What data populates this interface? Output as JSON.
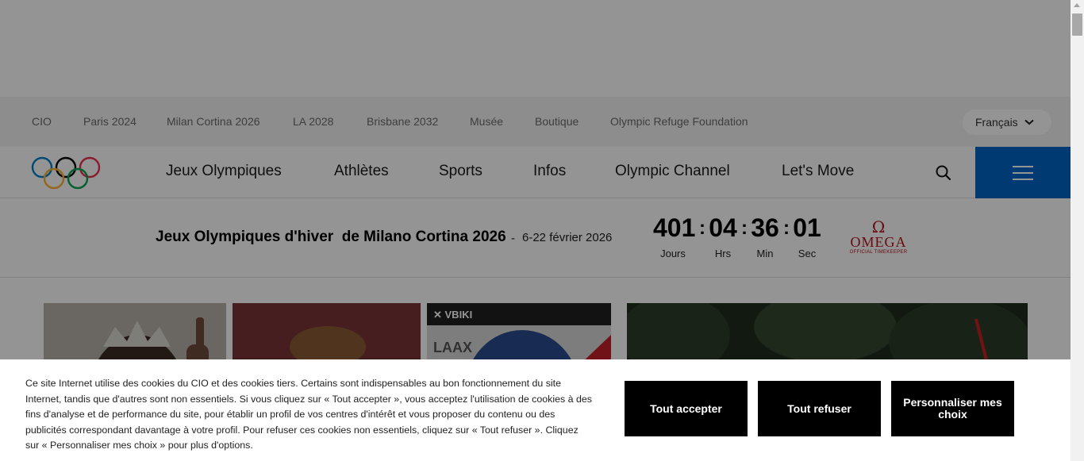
{
  "topbar": {
    "links": [
      "CIO",
      "Paris 2024",
      "Milan Cortina 2026",
      "LA 2028",
      "Brisbane 2032",
      "Musée",
      "Boutique",
      "Olympic Refuge Foundation"
    ],
    "language": "Français"
  },
  "mainnav": {
    "items": [
      "Jeux Olympiques",
      "Athlètes",
      "Sports",
      "Infos",
      "Olympic Channel",
      "Let's Move"
    ]
  },
  "countdown": {
    "title": "Jeux Olympiques d'hiver  de Milano Cortina 2026",
    "dash": "-",
    "dates": "6-22 février 2026",
    "units": [
      {
        "value": "401",
        "label": "Jours"
      },
      {
        "value": "04",
        "label": "Hrs"
      },
      {
        "value": "36",
        "label": "Min"
      },
      {
        "value": "01",
        "label": "Sec"
      }
    ],
    "separator": ":",
    "sponsor": {
      "symbol": "Ω",
      "name": "OMEGA",
      "tagline": "OFFICIAL TIMEKEEPER"
    }
  },
  "cookie_banner": {
    "text": "Ce site Internet utilise des cookies du CIO et des cookies tiers. Certains sont indispensables au bon fonctionnement du site Internet, tandis que d'autres sont non essentiels. Si vous cliquez sur « Tout accepter », vous acceptez l'utilisation de cookies à des fins d'analyse et de performance du site, pour établir un profil de vos centres d'intérêt et vous proposer du contenu ou des publicités correspondant davantage à votre profil. Pour refuser ces cookies non essentiels, cliquez sur « Tout refuser ». Cliquez sur « Personnaliser mes choix » pour plus d'options.",
    "accept_label": "Tout accepter",
    "reject_label": "Tout refuser",
    "customize_label": "Personnaliser mes choix"
  },
  "colors": {
    "brand_blue": "#0064c6",
    "omega_red": "#b4121b",
    "ring_blue": "#0081c8",
    "ring_yellow": "#fcb131",
    "ring_black": "#000000",
    "ring_green": "#00a651",
    "ring_red": "#ee334e"
  },
  "icons": [
    "olympic-rings-logo",
    "chevron-down-icon",
    "search-icon",
    "hamburger-menu-icon"
  ]
}
